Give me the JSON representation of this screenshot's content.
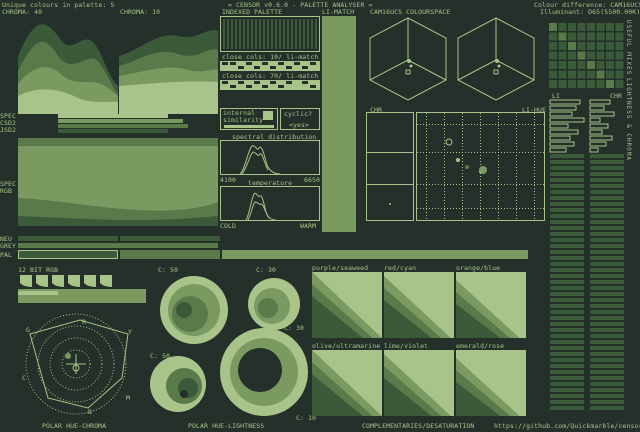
{
  "header": {
    "unique_colours": "Unique colours in palette: 5",
    "app_title": "= CENSOR v0.6.0 - PALETTE ANALYSER =",
    "colour_difference": "Colour difference: CAM16UCS",
    "illuminant": "Illuminant: D65(5500.00K)",
    "url": "https://github.com/Quickmarble/censor"
  },
  "labels": {
    "chroma40": "CHROMA: 40",
    "chroma10": "CHROMA: 10",
    "indexed_palette": "INDEXED PALETTE",
    "li_match": "LI-MATCH",
    "colourspace": "CAM16UCS COLOURSPACE",
    "useful_mixes": "USEFUL MIXES",
    "lightness_chroma": "LIGHTNESS & CHROMA",
    "close_cols_10": "close cols: 10/ li-match",
    "close_cols_70": "close cols: 70/ li-match",
    "internal_similarity": "internal similarity",
    "cyclic": "cyclic?",
    "yes": "<yes>",
    "spectral_distribution": "spectral distribution",
    "spec_low": "4100",
    "spec_high": "6650",
    "temperature": "temperature",
    "cold": "COLD",
    "warm": "WARM",
    "spec": "SPEC",
    "csd2": "CSD2",
    "jsd2": "JSD2",
    "spec2": "SPEC",
    "rgb": "RGB",
    "neu": "NEU",
    "grey": "GREY",
    "pal": "PAL",
    "chr1": "CHR",
    "li_hue": "LI-HUE",
    "li": "LI",
    "chr2": "CHR",
    "bit12": "12 BIT RGB",
    "c50_top": "C: 50",
    "c30_top": "C: 30",
    "c50": "C: 50",
    "c30": "C: 30",
    "c10": "C: 10",
    "polar_hue_chroma": "POLAR HUE-CHROMA",
    "polar_hue_lightness": "POLAR HUE-LIGHTNESS",
    "complementaries": "COMPLEMENTARIES/DESATURATION",
    "purple_seaweed": "purple/seaweed",
    "red_cyan": "red/cyan",
    "orange_blue": "orange/blue",
    "olive_ultramarine": "olive/ultramarine",
    "lime_violet": "lime/violet",
    "emerald_rose": "emerald/rose",
    "wheel_r": "R",
    "wheel_y": "Y",
    "wheel_g": "G",
    "wheel_c": "C",
    "wheel_b": "B",
    "wheel_m": "M"
  },
  "palette": {
    "colors": [
      "#243029",
      "#3a5a3a",
      "#5a7a4a",
      "#7a9a62",
      "#a8c48a"
    ]
  }
}
